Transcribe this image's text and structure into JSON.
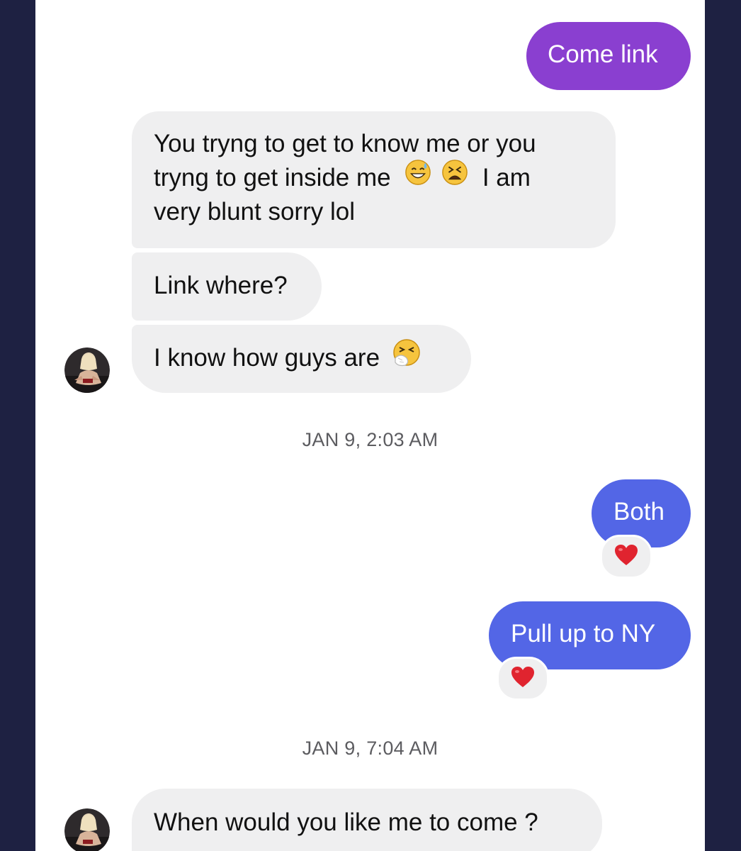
{
  "conversation": {
    "messages": [
      {
        "id": "m1",
        "direction": "outgoing",
        "text": "Come link"
      },
      {
        "id": "m2",
        "direction": "incoming",
        "lines": [
          "You tryng to get to know me or you",
          "tryng to get inside me",
          "I am",
          "very blunt sorry lol"
        ],
        "emojis": [
          "sweat-smile-emoji",
          "tired-face-emoji"
        ]
      },
      {
        "id": "m3",
        "direction": "incoming",
        "text": "Link where?"
      },
      {
        "id": "m4",
        "direction": "incoming",
        "text": "I know how guys are",
        "emojis": [
          "sneezing-face-emoji"
        ]
      },
      {
        "id": "m5",
        "direction": "outgoing",
        "text": "Both",
        "reaction": "red-heart"
      },
      {
        "id": "m6",
        "direction": "outgoing",
        "text": "Pull up to NY",
        "reaction": "red-heart"
      },
      {
        "id": "m7",
        "direction": "incoming",
        "text": "When would you like me to come ?"
      }
    ],
    "timestamps": [
      "JAN 9, 2:03 AM",
      "JAN 9, 7:04 AM"
    ]
  },
  "colors": {
    "outgoing_purple": "#8a3fd0",
    "outgoing_blue": "#5366e6",
    "incoming_gray": "#efeff0",
    "frame_background": "#1e2142"
  }
}
